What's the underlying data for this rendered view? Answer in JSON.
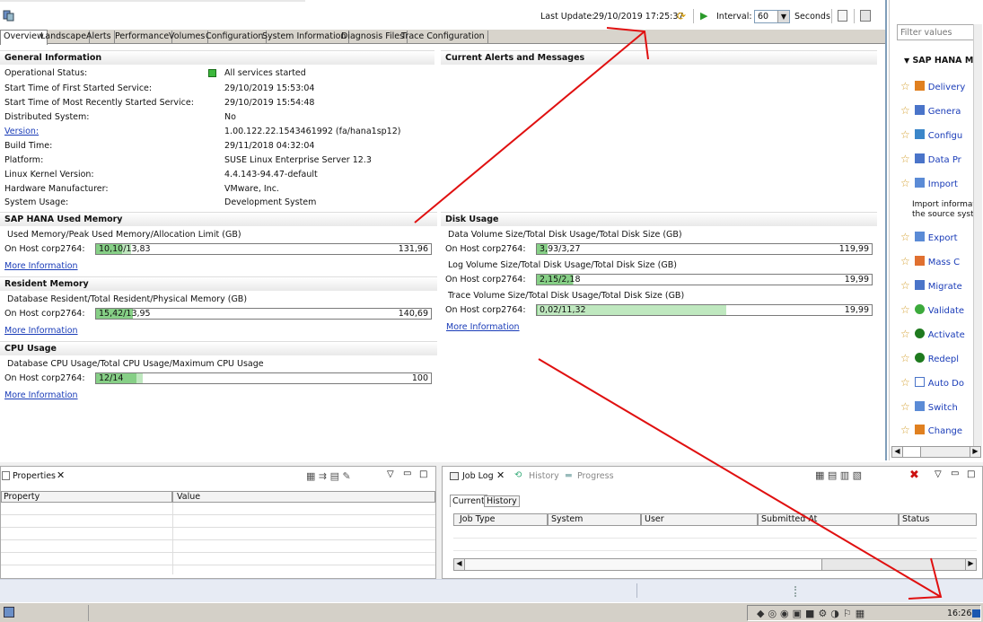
{
  "toolbar": {
    "last_update_label": "Last Update:",
    "last_update_value": "29/10/2019 17:25:37",
    "interval_label": "Interval:",
    "interval_value": "60",
    "seconds_label": "Seconds"
  },
  "tabs": [
    "Overview",
    "Landscape",
    "Alerts",
    "Performance",
    "Volumes",
    "Configuration",
    "System Information",
    "Diagnosis Files",
    "Trace Configuration"
  ],
  "general": {
    "title": "General Information",
    "rows": [
      {
        "label": "Operational Status:",
        "value": "All services started"
      },
      {
        "label": "Start Time of First Started Service:",
        "value": "29/10/2019 15:53:04"
      },
      {
        "label": "Start Time of Most Recently Started Service:",
        "value": "29/10/2019 15:54:48"
      },
      {
        "label": "Distributed System:",
        "value": "No"
      },
      {
        "label": "Version:",
        "value": "1.00.122.22.1543461992 (fa/hana1sp12)"
      },
      {
        "label": "Build Time:",
        "value": "29/11/2018 04:32:04"
      },
      {
        "label": "Platform:",
        "value": "SUSE Linux Enterprise Server 12.3"
      },
      {
        "label": "Linux Kernel Version:",
        "value": "4.4.143-94.47-default"
      },
      {
        "label": "Hardware Manufacturer:",
        "value": "VMware, Inc."
      },
      {
        "label": "System Usage:",
        "value": "Development System"
      }
    ]
  },
  "alerts": {
    "title": "Current Alerts and Messages"
  },
  "memory": {
    "title": "SAP HANA Used Memory",
    "subtitle": "Used Memory/Peak Used Memory/Allocation Limit (GB)",
    "host": "On Host corp2764:",
    "value": "10,10/13,83",
    "max": "131,96",
    "used_fraction": 0.077,
    "peak_fraction": 0.105,
    "more": "More Information"
  },
  "resident": {
    "title": "Resident Memory",
    "subtitle": "Database Resident/Total Resident/Physical Memory (GB)",
    "host": "On Host corp2764:",
    "value": "15,42/13,95",
    "max": "140,69",
    "used_fraction": 0.11,
    "peak_fraction": 0.1,
    "more": "More Information"
  },
  "cpu": {
    "title": "CPU Usage",
    "subtitle": "Database CPU Usage/Total CPU Usage/Maximum CPU Usage",
    "host": "On Host corp2764:",
    "value": "12/14",
    "max": "100",
    "used_fraction": 0.12,
    "peak_fraction": 0.14,
    "more": "More Information"
  },
  "disk": {
    "title": "Disk Usage",
    "data": {
      "subtitle": "Data Volume Size/Total Disk Usage/Total Disk Size (GB)",
      "host": "On Host corp2764:",
      "value": "3,93/3,27",
      "max": "119,99",
      "used_fraction": 0.033,
      "peak_fraction": 0.027
    },
    "log": {
      "subtitle": "Log Volume Size/Total Disk Usage/Total Disk Size (GB)",
      "host": "On Host corp2764:",
      "value": "2,15/2,18",
      "max": "19,99",
      "used_fraction": 0.108,
      "peak_fraction": 0.109
    },
    "trace": {
      "subtitle": "Trace Volume Size/Total Disk Usage/Total Disk Size (GB)",
      "host": "On Host corp2764:",
      "value": "0,02/11,32",
      "max": "19,99",
      "used_fraction": 0.001,
      "peak_fraction": 0.566
    },
    "more": "More Information"
  },
  "right": {
    "filter_placeholder": "Filter values",
    "section": "SAP HANA Mo",
    "items": [
      "Delivery",
      "Genera",
      "Configu",
      "Data Pr",
      "Import",
      "Export",
      "Mass C",
      "Migrate",
      "Validate",
      "Activate",
      "Redepl",
      "Auto Do",
      "Switch",
      "Change"
    ],
    "import_desc1": "Import informati",
    "import_desc2": "the source syste"
  },
  "properties": {
    "tab": "Properties",
    "col_property": "Property",
    "col_value": "Value"
  },
  "joblog": {
    "tab": "Job Log",
    "tab_history": "History",
    "tab_progress": "Progress",
    "sub_current": "Current",
    "sub_history": "History",
    "cols": [
      "Job Type",
      "System",
      "User",
      "Submitted At",
      "Status"
    ]
  },
  "taskbar": {
    "clock": "16:26"
  }
}
